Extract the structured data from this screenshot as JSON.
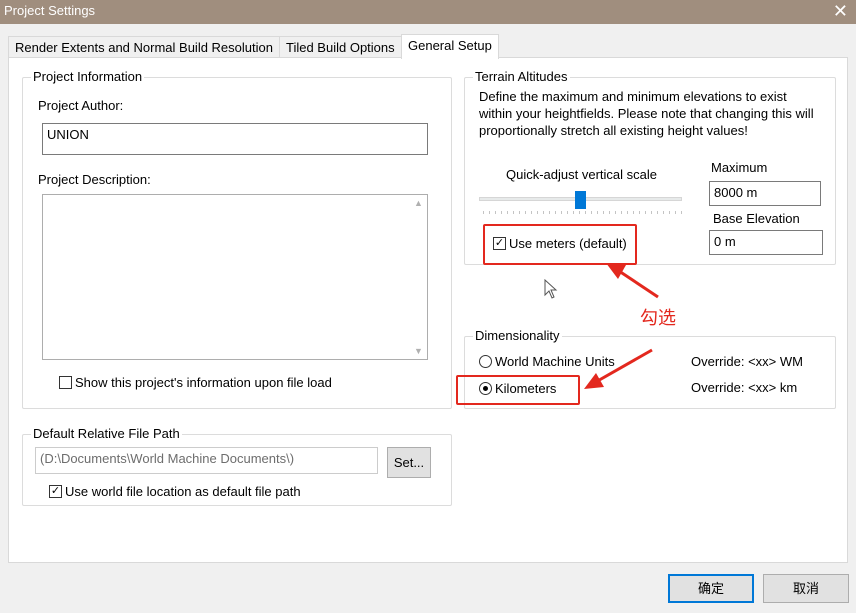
{
  "window": {
    "title": "Project Settings",
    "close": "✕"
  },
  "tabs": [
    {
      "label": "Render Extents and Normal Build Resolution"
    },
    {
      "label": "Tiled Build Options"
    },
    {
      "label": "General Setup"
    }
  ],
  "project_info": {
    "group_label": "Project Information",
    "author_label": "Project Author:",
    "author_value": "UNION",
    "description_label": "Project Description:",
    "description_value": "",
    "show_info_label": "Show this project's information upon file load",
    "show_info_checked": false
  },
  "file_path": {
    "group_label": "Default Relative File Path",
    "path_value": "(D:\\Documents\\World Machine Documents\\)",
    "set_button": "Set...",
    "use_world_label": "Use world file location as default file path",
    "use_world_checked": true
  },
  "terrain": {
    "group_label": "Terrain Altitudes",
    "description_line1": "Define the maximum and minimum elevations to exist",
    "description_line2": "within your heightfields. Please note that changing this will",
    "description_line3": "proportionally stretch all existing height values!",
    "slider_label": "Quick-adjust vertical scale",
    "slider_value_fraction": 0.5,
    "maximum_label": "Maximum",
    "maximum_value": "8000 m",
    "base_label": "Base Elevation",
    "base_value": "0 m",
    "use_meters_label": "Use meters (default)",
    "use_meters_checked": true
  },
  "dimensionality": {
    "group_label": "Dimensionality",
    "options": [
      {
        "label": "World Machine Units",
        "override": "Override: <xx> WM",
        "selected": false
      },
      {
        "label": "Kilometers",
        "override": "Override: <xx> km",
        "selected": true
      }
    ]
  },
  "annotation": {
    "text": "勾选"
  },
  "footer": {
    "ok": "确定",
    "cancel": "取消"
  },
  "colors": {
    "titlebar": "#a08e7e",
    "accent": "#0078d7",
    "annotation": "#e3281e"
  }
}
